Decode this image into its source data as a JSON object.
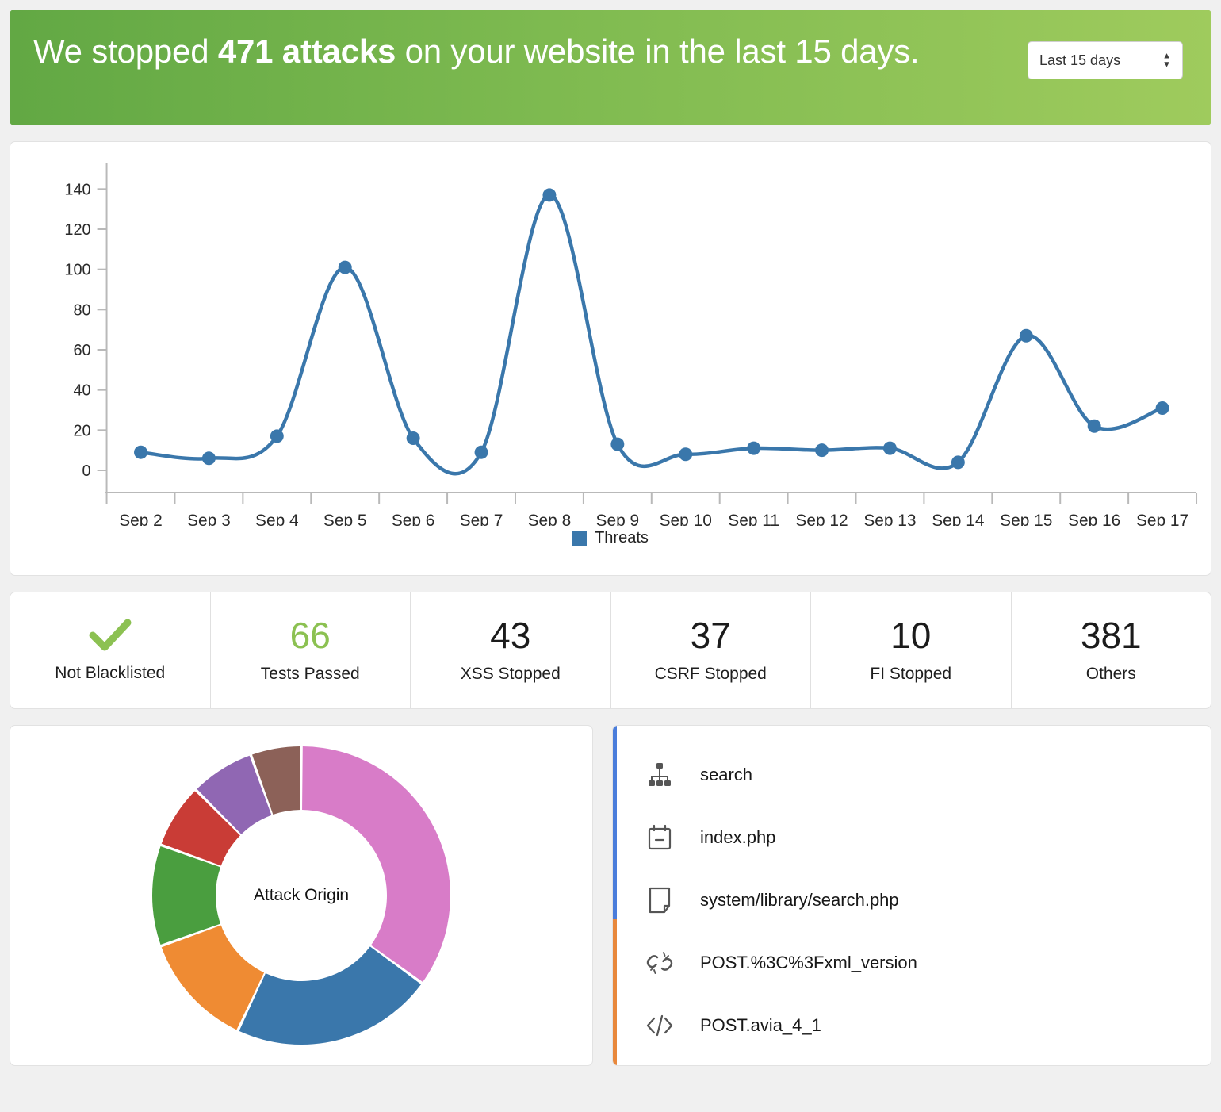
{
  "header": {
    "title_prefix": "We stopped ",
    "title_highlight": "471 attacks",
    "title_suffix": " on your website in the last 15 days.",
    "range_value": "Last 15 days",
    "brand_green": "#7eba50"
  },
  "legend": {
    "label": "Threats",
    "color": "#3a77ab"
  },
  "chart_data": {
    "type": "line",
    "title": "",
    "xlabel": "",
    "ylabel": "",
    "ylim": [
      0,
      150
    ],
    "yticks": [
      0,
      20,
      40,
      60,
      80,
      100,
      120,
      140
    ],
    "grid": false,
    "legend_position": "bottom",
    "categories": [
      "Sep 2",
      "Sep 3",
      "Sep 4",
      "Sep 5",
      "Sep 6",
      "Sep 7",
      "Sep 8",
      "Sep 9",
      "Sep 10",
      "Sep 11",
      "Sep 12",
      "Sep 13",
      "Sep 14",
      "Sep 15",
      "Sep 16",
      "Sep 17"
    ],
    "series": [
      {
        "name": "Threats",
        "color": "#3a77ab",
        "values": [
          9,
          6,
          17,
          101,
          16,
          9,
          137,
          13,
          8,
          11,
          10,
          11,
          4,
          67,
          22,
          31
        ]
      }
    ]
  },
  "stats": [
    {
      "value": "",
      "label": "Not Blacklisted",
      "icon": "check-icon",
      "value_color": "#8cc152"
    },
    {
      "value": "66",
      "label": "Tests Passed",
      "icon": "",
      "value_color": "#8cc152"
    },
    {
      "value": "43",
      "label": "XSS Stopped",
      "icon": "",
      "value_color": "#1b1b1b"
    },
    {
      "value": "37",
      "label": "CSRF Stopped",
      "icon": "",
      "value_color": "#1b1b1b"
    },
    {
      "value": "10",
      "label": "FI Stopped",
      "icon": "",
      "value_color": "#1b1b1b"
    },
    {
      "value": "381",
      "label": "Others",
      "icon": "",
      "value_color": "#1b1b1b"
    }
  ],
  "donut": {
    "type": "pie",
    "center_label": "Attack Origin",
    "title": "Attack Origin",
    "values": [
      35,
      22,
      12.5,
      11,
      7,
      7,
      5.5
    ],
    "colors": [
      "#d87cc8",
      "#3a77ab",
      "#ef8b33",
      "#4a9e3f",
      "#c93c36",
      "#9067b3",
      "#8c6158"
    ]
  },
  "attack_list": {
    "accent_colors": [
      "#4a7ddb",
      "#e8883c"
    ],
    "items": [
      {
        "label": "search",
        "icon": "sitemap-icon"
      },
      {
        "label": "index.php",
        "icon": "calendar-note-icon"
      },
      {
        "label": "system/library/search.php",
        "icon": "file-page-icon"
      },
      {
        "label": "POST.%3C%3Fxml_version",
        "icon": "broken-link-icon"
      },
      {
        "label": "POST.avia_4_1",
        "icon": "code-icon"
      }
    ]
  }
}
